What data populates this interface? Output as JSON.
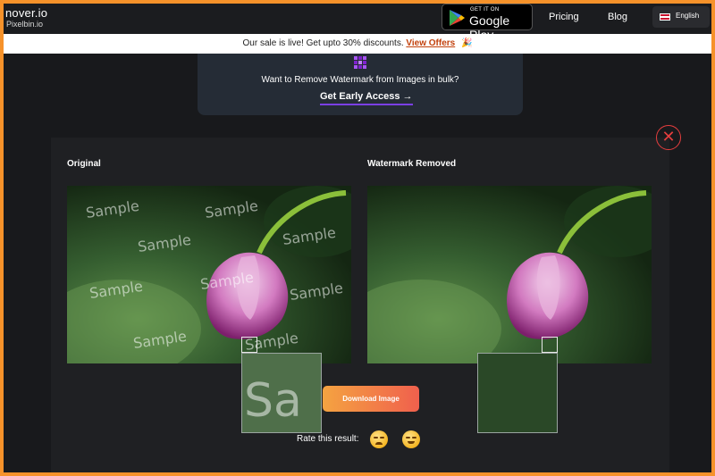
{
  "header": {
    "logo_main": "nover.io",
    "logo_sub": "Pixelbin.io",
    "store_badge": {
      "top": "GET IT ON",
      "main": "Google Play",
      "icon": "google-play-icon"
    },
    "nav": [
      "Pricing",
      "Blog"
    ],
    "language": "English"
  },
  "sale_bar": {
    "text": "Our sale is live! Get upto 30% discounts.",
    "link": "View Offers",
    "icon": "party-horn-icon"
  },
  "promo": {
    "icon": "bulk-grid-icon",
    "text": "Want to Remove Watermark from Images in bulk?",
    "cta": "Get Early Access",
    "cta_arrow": "→"
  },
  "result": {
    "original_label": "Original",
    "removed_label": "Watermark Removed",
    "watermark_text": "Sample",
    "zoom_text": "Sa",
    "download_label": "Download Image",
    "rate_label": "Rate this result:",
    "ratings": [
      "sad-face-icon",
      "happy-face-icon"
    ],
    "close_symbol": "✕"
  },
  "colors": {
    "accent_orange": "#f6922a",
    "accent_red": "#e53e3e",
    "cta_underline": "#7b3fe4",
    "download_gradient_start": "#f4a341",
    "download_gradient_end": "#f0604d"
  }
}
